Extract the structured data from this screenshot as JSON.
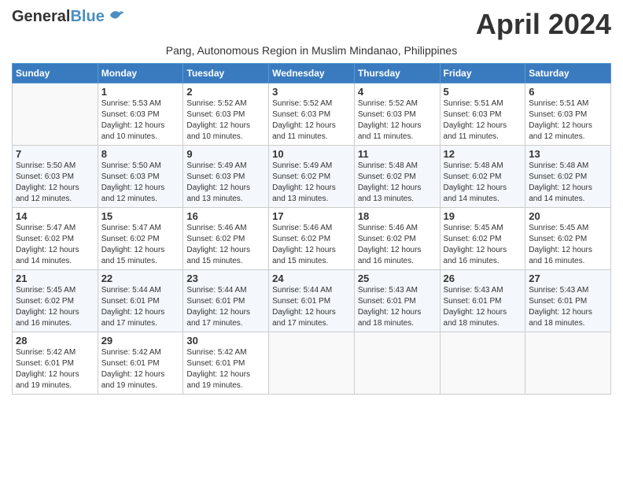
{
  "header": {
    "logo_general": "General",
    "logo_blue": "Blue",
    "month_title": "April 2024",
    "subtitle": "Pang, Autonomous Region in Muslim Mindanao, Philippines"
  },
  "calendar": {
    "headers": [
      "Sunday",
      "Monday",
      "Tuesday",
      "Wednesday",
      "Thursday",
      "Friday",
      "Saturday"
    ],
    "rows": [
      [
        {
          "day": "",
          "sunrise": "",
          "sunset": "",
          "daylight": ""
        },
        {
          "day": "1",
          "sunrise": "Sunrise: 5:53 AM",
          "sunset": "Sunset: 6:03 PM",
          "daylight": "Daylight: 12 hours and 10 minutes."
        },
        {
          "day": "2",
          "sunrise": "Sunrise: 5:52 AM",
          "sunset": "Sunset: 6:03 PM",
          "daylight": "Daylight: 12 hours and 10 minutes."
        },
        {
          "day": "3",
          "sunrise": "Sunrise: 5:52 AM",
          "sunset": "Sunset: 6:03 PM",
          "daylight": "Daylight: 12 hours and 11 minutes."
        },
        {
          "day": "4",
          "sunrise": "Sunrise: 5:52 AM",
          "sunset": "Sunset: 6:03 PM",
          "daylight": "Daylight: 12 hours and 11 minutes."
        },
        {
          "day": "5",
          "sunrise": "Sunrise: 5:51 AM",
          "sunset": "Sunset: 6:03 PM",
          "daylight": "Daylight: 12 hours and 11 minutes."
        },
        {
          "day": "6",
          "sunrise": "Sunrise: 5:51 AM",
          "sunset": "Sunset: 6:03 PM",
          "daylight": "Daylight: 12 hours and 12 minutes."
        }
      ],
      [
        {
          "day": "7",
          "sunrise": "Sunrise: 5:50 AM",
          "sunset": "Sunset: 6:03 PM",
          "daylight": "Daylight: 12 hours and 12 minutes."
        },
        {
          "day": "8",
          "sunrise": "Sunrise: 5:50 AM",
          "sunset": "Sunset: 6:03 PM",
          "daylight": "Daylight: 12 hours and 12 minutes."
        },
        {
          "day": "9",
          "sunrise": "Sunrise: 5:49 AM",
          "sunset": "Sunset: 6:03 PM",
          "daylight": "Daylight: 12 hours and 13 minutes."
        },
        {
          "day": "10",
          "sunrise": "Sunrise: 5:49 AM",
          "sunset": "Sunset: 6:02 PM",
          "daylight": "Daylight: 12 hours and 13 minutes."
        },
        {
          "day": "11",
          "sunrise": "Sunrise: 5:48 AM",
          "sunset": "Sunset: 6:02 PM",
          "daylight": "Daylight: 12 hours and 13 minutes."
        },
        {
          "day": "12",
          "sunrise": "Sunrise: 5:48 AM",
          "sunset": "Sunset: 6:02 PM",
          "daylight": "Daylight: 12 hours and 14 minutes."
        },
        {
          "day": "13",
          "sunrise": "Sunrise: 5:48 AM",
          "sunset": "Sunset: 6:02 PM",
          "daylight": "Daylight: 12 hours and 14 minutes."
        }
      ],
      [
        {
          "day": "14",
          "sunrise": "Sunrise: 5:47 AM",
          "sunset": "Sunset: 6:02 PM",
          "daylight": "Daylight: 12 hours and 14 minutes."
        },
        {
          "day": "15",
          "sunrise": "Sunrise: 5:47 AM",
          "sunset": "Sunset: 6:02 PM",
          "daylight": "Daylight: 12 hours and 15 minutes."
        },
        {
          "day": "16",
          "sunrise": "Sunrise: 5:46 AM",
          "sunset": "Sunset: 6:02 PM",
          "daylight": "Daylight: 12 hours and 15 minutes."
        },
        {
          "day": "17",
          "sunrise": "Sunrise: 5:46 AM",
          "sunset": "Sunset: 6:02 PM",
          "daylight": "Daylight: 12 hours and 15 minutes."
        },
        {
          "day": "18",
          "sunrise": "Sunrise: 5:46 AM",
          "sunset": "Sunset: 6:02 PM",
          "daylight": "Daylight: 12 hours and 16 minutes."
        },
        {
          "day": "19",
          "sunrise": "Sunrise: 5:45 AM",
          "sunset": "Sunset: 6:02 PM",
          "daylight": "Daylight: 12 hours and 16 minutes."
        },
        {
          "day": "20",
          "sunrise": "Sunrise: 5:45 AM",
          "sunset": "Sunset: 6:02 PM",
          "daylight": "Daylight: 12 hours and 16 minutes."
        }
      ],
      [
        {
          "day": "21",
          "sunrise": "Sunrise: 5:45 AM",
          "sunset": "Sunset: 6:02 PM",
          "daylight": "Daylight: 12 hours and 16 minutes."
        },
        {
          "day": "22",
          "sunrise": "Sunrise: 5:44 AM",
          "sunset": "Sunset: 6:01 PM",
          "daylight": "Daylight: 12 hours and 17 minutes."
        },
        {
          "day": "23",
          "sunrise": "Sunrise: 5:44 AM",
          "sunset": "Sunset: 6:01 PM",
          "daylight": "Daylight: 12 hours and 17 minutes."
        },
        {
          "day": "24",
          "sunrise": "Sunrise: 5:44 AM",
          "sunset": "Sunset: 6:01 PM",
          "daylight": "Daylight: 12 hours and 17 minutes."
        },
        {
          "day": "25",
          "sunrise": "Sunrise: 5:43 AM",
          "sunset": "Sunset: 6:01 PM",
          "daylight": "Daylight: 12 hours and 18 minutes."
        },
        {
          "day": "26",
          "sunrise": "Sunrise: 5:43 AM",
          "sunset": "Sunset: 6:01 PM",
          "daylight": "Daylight: 12 hours and 18 minutes."
        },
        {
          "day": "27",
          "sunrise": "Sunrise: 5:43 AM",
          "sunset": "Sunset: 6:01 PM",
          "daylight": "Daylight: 12 hours and 18 minutes."
        }
      ],
      [
        {
          "day": "28",
          "sunrise": "Sunrise: 5:42 AM",
          "sunset": "Sunset: 6:01 PM",
          "daylight": "Daylight: 12 hours and 19 minutes."
        },
        {
          "day": "29",
          "sunrise": "Sunrise: 5:42 AM",
          "sunset": "Sunset: 6:01 PM",
          "daylight": "Daylight: 12 hours and 19 minutes."
        },
        {
          "day": "30",
          "sunrise": "Sunrise: 5:42 AM",
          "sunset": "Sunset: 6:01 PM",
          "daylight": "Daylight: 12 hours and 19 minutes."
        },
        {
          "day": "",
          "sunrise": "",
          "sunset": "",
          "daylight": ""
        },
        {
          "day": "",
          "sunrise": "",
          "sunset": "",
          "daylight": ""
        },
        {
          "day": "",
          "sunrise": "",
          "sunset": "",
          "daylight": ""
        },
        {
          "day": "",
          "sunrise": "",
          "sunset": "",
          "daylight": ""
        }
      ]
    ]
  }
}
